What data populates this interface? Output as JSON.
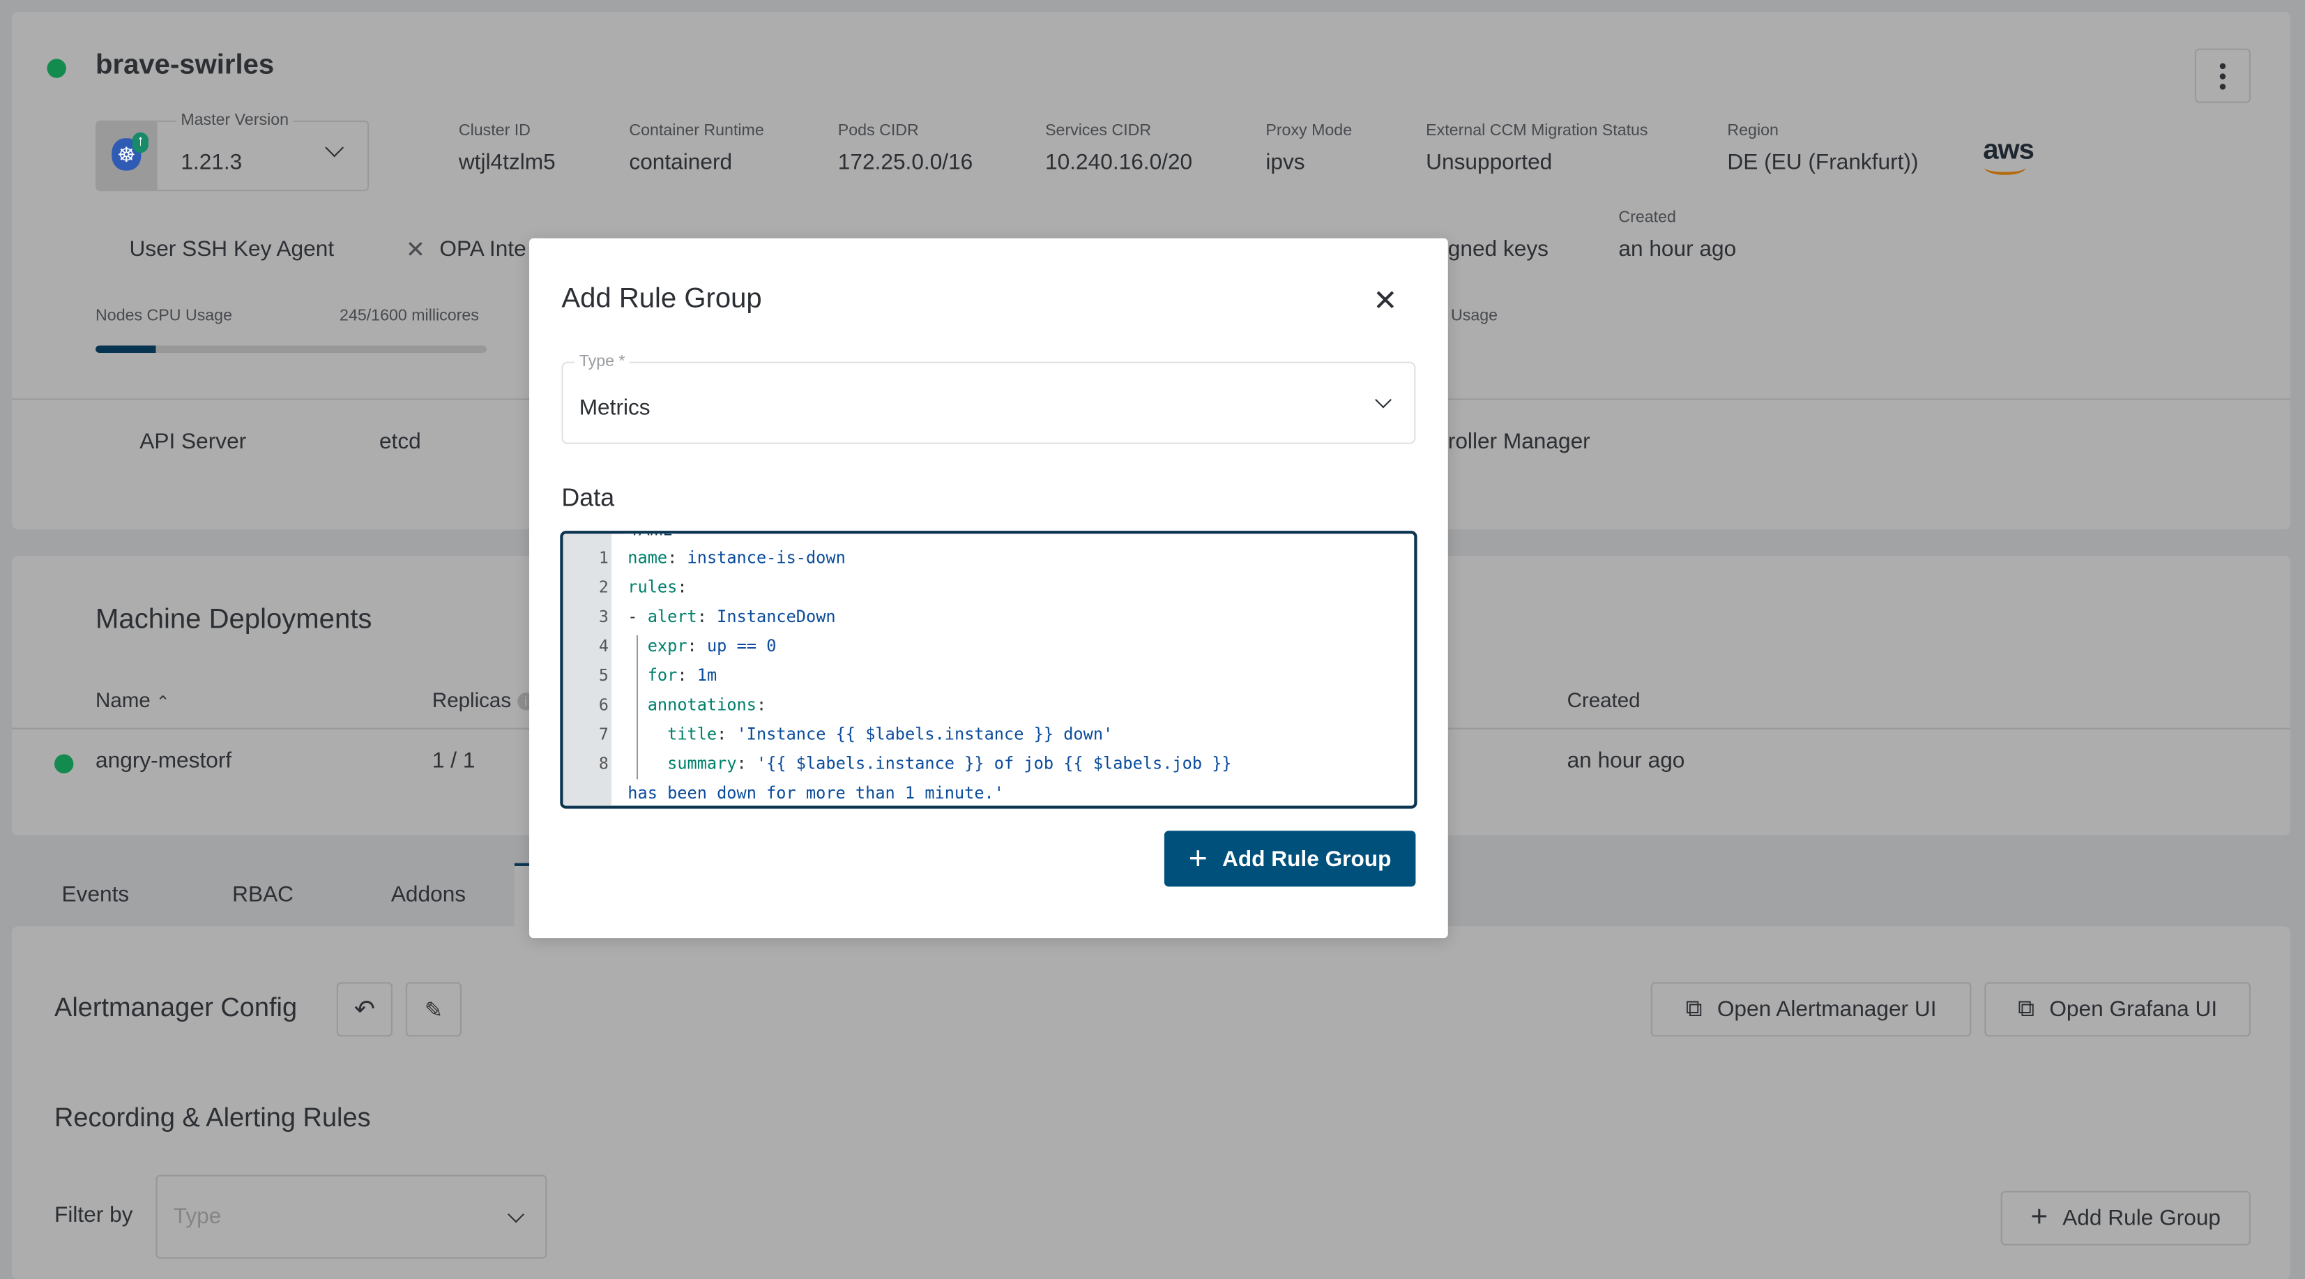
{
  "cluster": {
    "name": "brave-swirles",
    "status_color": "#138a4e",
    "master_version": {
      "label": "Master Version",
      "value": "1.21.3"
    },
    "info": [
      {
        "label": "Cluster ID",
        "value": "wtjl4tzlm5"
      },
      {
        "label": "Container Runtime",
        "value": "containerd"
      },
      {
        "label": "Pods CIDR",
        "value": "172.25.0.0/16"
      },
      {
        "label": "Services CIDR",
        "value": "10.240.16.0/20"
      },
      {
        "label": "Proxy Mode",
        "value": "ipvs"
      },
      {
        "label": "External CCM Migration Status",
        "value": "Unsupported"
      },
      {
        "label": "Region",
        "value": "DE (EU (Frankfurt))"
      }
    ],
    "provider_logo": "aws",
    "features": [
      "User SSH Key Agent",
      "OPA Inte",
      "gned keys"
    ],
    "created": {
      "label": "Created",
      "value": "an hour ago"
    },
    "cpu_usage": {
      "label": "Nodes CPU Usage",
      "value": "245/1600 millicores",
      "fraction": 0.153
    },
    "memory_usage_partial_label": "Usage",
    "components": [
      "API Server",
      "etcd",
      "roller Manager"
    ]
  },
  "machine_deployments": {
    "title": "Machine Deployments",
    "columns": {
      "name": "Name",
      "replicas": "Replicas",
      "created": "Created"
    },
    "rows": [
      {
        "name": "angry-mestorf",
        "replicas": "1 / 1",
        "created": "an hour ago"
      }
    ]
  },
  "tabs": [
    "Events",
    "RBAC",
    "Addons"
  ],
  "monitoring": {
    "alertmanager_title": "Alertmanager Config",
    "open_alertmanager": "Open Alertmanager UI",
    "open_grafana": "Open Grafana UI",
    "rules_title": "Recording & Alerting Rules",
    "filter_label": "Filter by",
    "filter_placeholder": "Type",
    "add_rule_group": "Add Rule Group"
  },
  "modal": {
    "title": "Add Rule Group",
    "type_label": "Type *",
    "type_value": "Metrics",
    "data_label": "Data",
    "editor_legend": "YAML",
    "line_numbers": [
      "1",
      "2",
      "3",
      "4",
      "5",
      "6",
      "7",
      "8"
    ],
    "code": {
      "l1k": "name",
      "l1v": "instance-is-down",
      "l2k": "rules",
      "l3k": "alert",
      "l3v": "InstanceDown",
      "l4k": "expr",
      "l4v": "up == 0",
      "l5k": "for",
      "l5v": "1m",
      "l6k": "annotations",
      "l7k": "title",
      "l7v": "'Instance {{ $labels.instance }} down'",
      "l8k": "summary",
      "l8v": "'{{ $labels.instance }} of job {{ $labels.job }}",
      "l8cont": "has been down for more than 1 minute.'"
    },
    "submit_label": "Add Rule Group",
    "accent_color": "#00507c"
  }
}
